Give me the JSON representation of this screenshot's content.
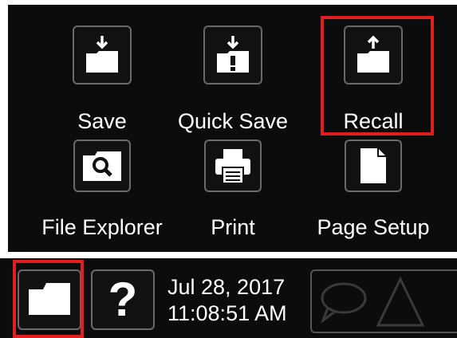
{
  "menu": {
    "items": [
      {
        "label": "Save",
        "icon": "save-icon"
      },
      {
        "label": "Quick Save",
        "icon": "quick-save-icon"
      },
      {
        "label": "Recall",
        "icon": "recall-icon",
        "selected": true
      },
      {
        "label": "File Explorer",
        "icon": "file-explorer-icon"
      },
      {
        "label": "Print",
        "icon": "print-icon"
      },
      {
        "label": "Page Setup",
        "icon": "page-setup-icon"
      }
    ]
  },
  "taskbar": {
    "folder_icon": "folder-icon",
    "help_glyph": "?",
    "date": "Jul 28, 2017",
    "time": "11:08:51 AM",
    "status_icons": [
      "speech-bubble-icon",
      "triangle-icon"
    ]
  },
  "colors": {
    "background": "#0c0c0c",
    "highlight": "#e02020",
    "icon_border": "#6a6a6a",
    "text": "#ffffff"
  }
}
